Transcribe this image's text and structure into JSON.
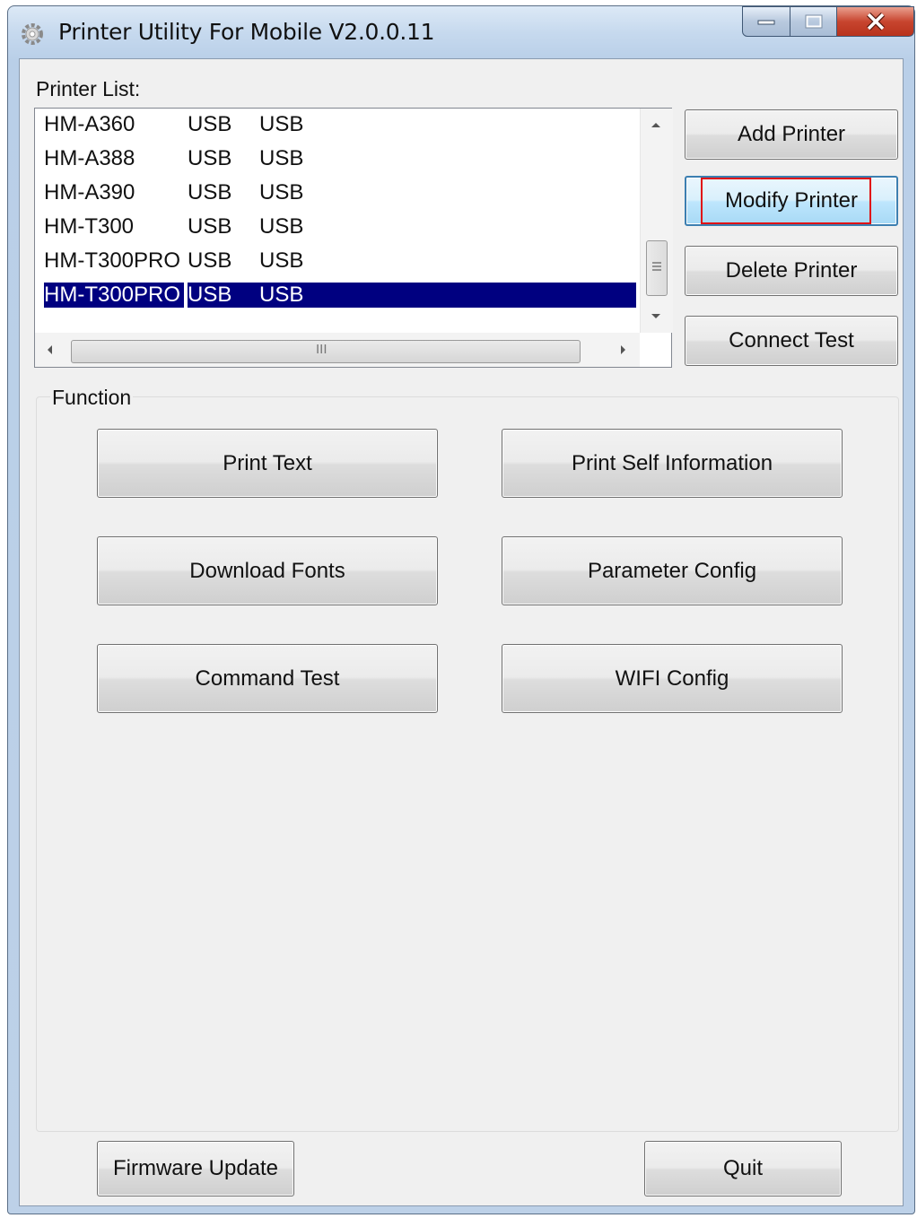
{
  "window": {
    "title": "Printer Utility For Mobile  V2.0.0.11",
    "caption_buttons": {
      "minimize": "minimize-icon",
      "maximize": "maximize-icon",
      "close": "close-icon"
    }
  },
  "printer_list": {
    "label": "Printer List:",
    "rows": [
      {
        "name": "HM-A360",
        "port": "USB",
        "type": "USB",
        "selected": false
      },
      {
        "name": "HM-A388",
        "port": "USB",
        "type": "USB",
        "selected": false
      },
      {
        "name": "HM-A390",
        "port": "USB",
        "type": "USB",
        "selected": false
      },
      {
        "name": "HM-T300",
        "port": "USB",
        "type": "USB",
        "selected": false
      },
      {
        "name": "HM-T300PRO",
        "port": "USB",
        "type": "USB",
        "selected": false
      },
      {
        "name": "HM-T300PRO",
        "port": "USB",
        "type": "USB",
        "selected": true
      }
    ],
    "hscroll_grip": "III"
  },
  "side_buttons": {
    "add": "Add Printer",
    "modify": "Modify Printer",
    "delete": "Delete Printer",
    "connect_test": "Connect Test"
  },
  "function": {
    "label": "Function",
    "print_text": "Print Text",
    "print_self_info": "Print Self Information",
    "download_fonts": "Download Fonts",
    "parameter_config": "Parameter Config",
    "command_test": "Command Test",
    "wifi_config": "WIFI Config"
  },
  "footer": {
    "firmware_update": "Firmware Update",
    "quit": "Quit"
  },
  "colors": {
    "selection": "#000080",
    "highlight_box": "#e01010",
    "focus_border": "#3c7fb1"
  }
}
